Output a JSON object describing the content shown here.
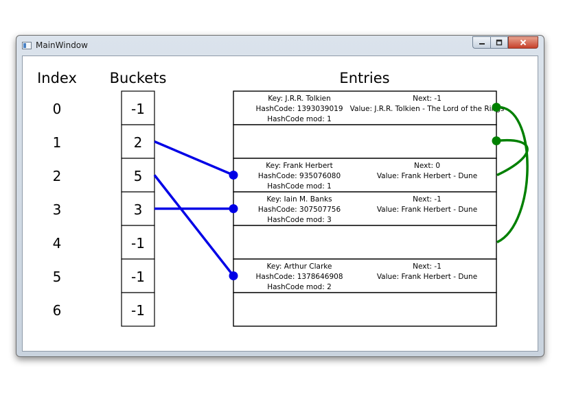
{
  "window": {
    "title": "MainWindow"
  },
  "caption_buttons": {
    "minimize_icon": "minimize-icon",
    "maximize_icon": "maximize-icon",
    "close_icon": "close-icon"
  },
  "headers": {
    "index": "Index",
    "buckets": "Buckets",
    "entries": "Entries"
  },
  "indices": [
    "0",
    "1",
    "2",
    "3",
    "4",
    "5",
    "6"
  ],
  "buckets": [
    "-1",
    "2",
    "5",
    "3",
    "-1",
    "-1",
    "-1"
  ],
  "entries": [
    {
      "key": "Key: J.R.R. Tolkien",
      "hashcode": "HashCode: 1393039019",
      "mod": "HashCode mod: 1",
      "next": "Next: -1",
      "value": "Value: J.R.R. Tolkien - The Lord of the Rings"
    },
    {
      "key": "",
      "hashcode": "",
      "mod": "",
      "next": "",
      "value": ""
    },
    {
      "key": "Key: Frank Herbert",
      "hashcode": "HashCode: 935076080",
      "mod": "HashCode mod: 1",
      "next": "Next: 0",
      "value": "Value: Frank Herbert - Dune"
    },
    {
      "key": "Key: Iain M. Banks",
      "hashcode": "HashCode: 307507756",
      "mod": "HashCode mod: 3",
      "next": "Next: -1",
      "value": "Value: Frank Herbert - Dune"
    },
    {
      "key": "",
      "hashcode": "",
      "mod": "",
      "next": "",
      "value": ""
    },
    {
      "key": "Key: Arthur Clarke",
      "hashcode": "HashCode: 1378646908",
      "mod": "HashCode mod: 2",
      "next": "Next: -1",
      "value": "Value: Frank Herbert - Dune"
    },
    {
      "key": "",
      "hashcode": "",
      "mod": "",
      "next": "",
      "value": ""
    }
  ],
  "bucket_links": [
    {
      "bucket": 1,
      "entry": 2
    },
    {
      "bucket": 2,
      "entry": 5
    },
    {
      "bucket": 3,
      "entry": 3
    }
  ],
  "next_links": [
    {
      "from": 0,
      "to": 4
    },
    {
      "from": 1,
      "to": 2
    }
  ],
  "colors": {
    "bucket_link": "#0000e6",
    "next_link": "#008000",
    "grid": "#000000"
  }
}
